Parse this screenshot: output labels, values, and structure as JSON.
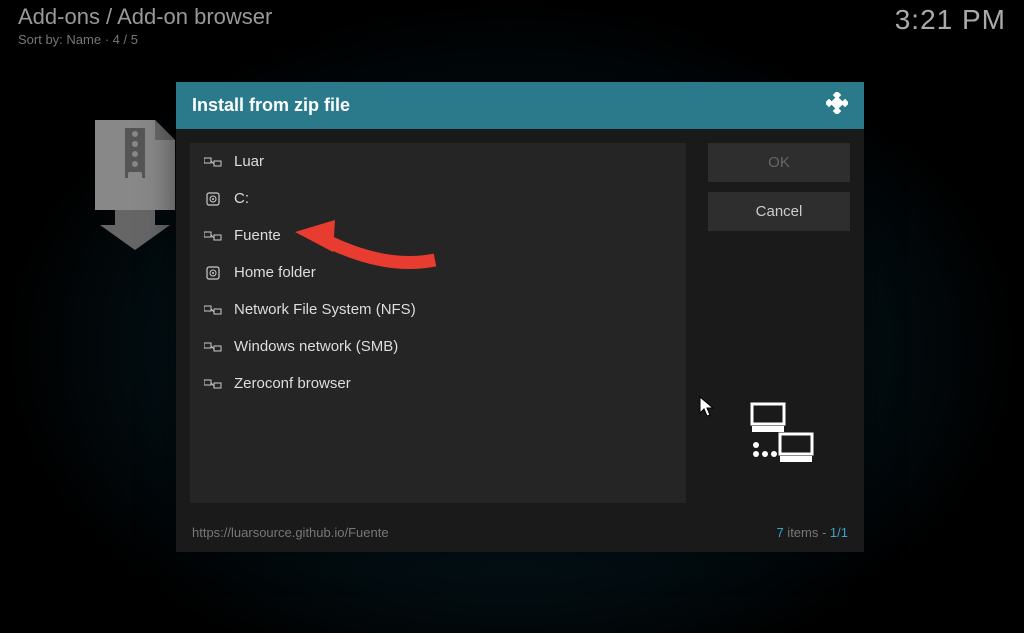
{
  "header": {
    "breadcrumb": "Add-ons / Add-on browser",
    "sort_label": "Sort by: Name",
    "position": "4 / 5",
    "time": "3:21 PM"
  },
  "dialog": {
    "title": "Install from zip file",
    "items": [
      {
        "label": "Luar",
        "icon": "network"
      },
      {
        "label": "C:",
        "icon": "drive"
      },
      {
        "label": "Fuente",
        "icon": "network"
      },
      {
        "label": "Home folder",
        "icon": "drive"
      },
      {
        "label": "Network File System (NFS)",
        "icon": "network"
      },
      {
        "label": "Windows network (SMB)",
        "icon": "network"
      },
      {
        "label": "Zeroconf browser",
        "icon": "network"
      }
    ],
    "buttons": {
      "ok": "OK",
      "cancel": "Cancel"
    },
    "footer": {
      "path": "https://luarsource.github.io/Fuente",
      "item_count": "7",
      "item_label": " items - ",
      "page": "1/1"
    }
  },
  "annotation": {
    "target_item": "Fuente"
  }
}
